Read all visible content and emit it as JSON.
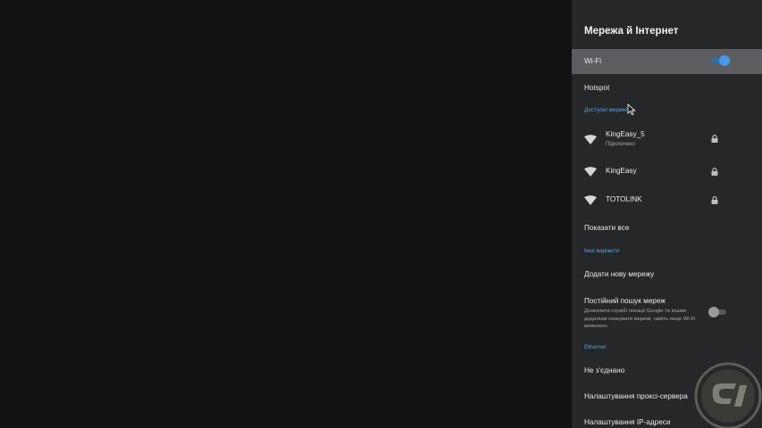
{
  "panel": {
    "title": "Мережа й Інтернет",
    "wifi": {
      "label": "Wi-Fi",
      "enabled": true
    },
    "hotspot_label": "Hotspot",
    "available_networks": {
      "header": "Доступні мережі",
      "networks": [
        {
          "name": "KingEasy_5",
          "status": "Підключено",
          "icon": "wifi-signal-icon",
          "secured": true
        },
        {
          "name": "KingEasy",
          "icon": "wifi-signal-icon",
          "secured": true
        },
        {
          "name": "TOTOLINK",
          "icon": "wifi-signal-icon",
          "secured": true
        }
      ],
      "show_all_label": "Показати все"
    },
    "other_options": {
      "header": "Інші варіанти",
      "add_network_label": "Додати нову мережу",
      "always_scan": {
        "label": "Постійний пошук мереж",
        "description": "Дозволити службі локації Google та іншим додаткам сканувати мережі, навіть якщо Wi-Fi вимкнено",
        "enabled": false
      }
    },
    "ethernet": {
      "header": "Ethernet",
      "status_label": "Не з'єднано",
      "proxy_label": "Налаштування проксі-сервера",
      "ip_label": "Налаштування IP-адреси"
    }
  },
  "colors": {
    "panel_background": "#262729",
    "focus_highlight": "#5c5d60",
    "accent_blue": "#4a98ea",
    "section_header_blue": "#5aa0e6"
  }
}
